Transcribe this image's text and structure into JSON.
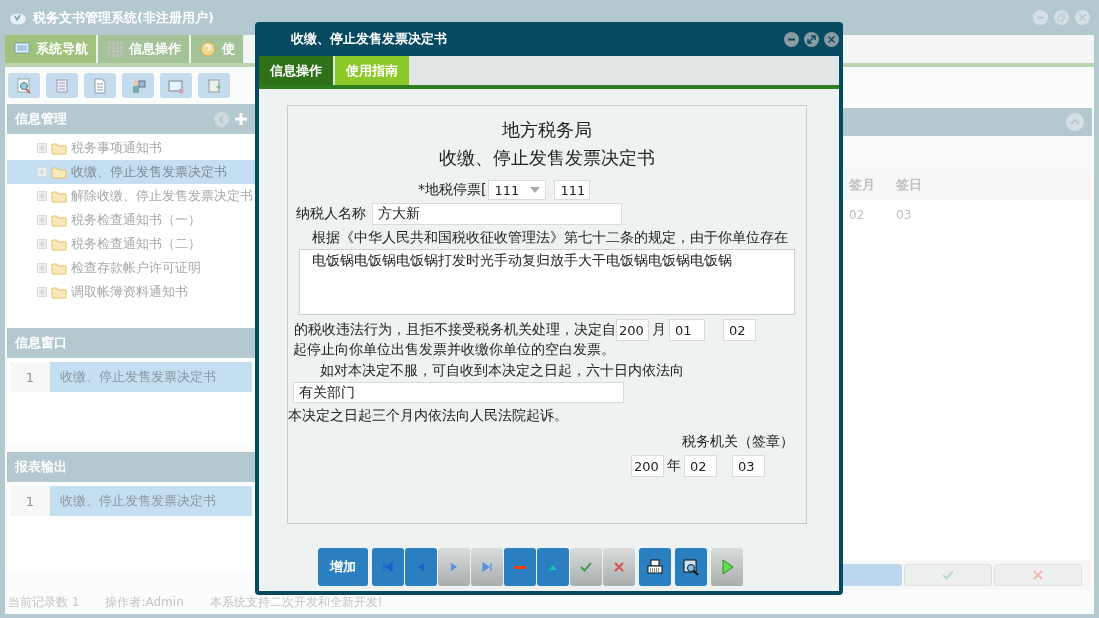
{
  "app": {
    "title": "税务文书管理系统(非注册用户)",
    "tabs": [
      {
        "label": "系统导航",
        "selected": true
      },
      {
        "label": "信息操作",
        "selected": false
      },
      {
        "label": "使",
        "selected": false
      }
    ]
  },
  "info_management": {
    "title": "信息管理",
    "items": [
      {
        "label": "税务事项通知书",
        "selected": false
      },
      {
        "label": "收缴、停止发售发票决定书",
        "selected": true
      },
      {
        "label": "解除收缴、停止发售发票决定书",
        "selected": false
      },
      {
        "label": "税务检查通知书（一）",
        "selected": false
      },
      {
        "label": "税务检查通知书（二）",
        "selected": false
      },
      {
        "label": "检查存款帐户许可证明",
        "selected": false
      },
      {
        "label": "调取帐簿资料通知书",
        "selected": false
      }
    ]
  },
  "info_window": {
    "title": "信息窗口",
    "rows": [
      {
        "index": "1",
        "label": "收缴、停止发售发票决定书",
        "selected": true
      }
    ]
  },
  "report_output": {
    "title": "报表输出",
    "rows": [
      {
        "index": "1",
        "label": "收缴、停止发售发票决定书",
        "selected": true
      }
    ]
  },
  "records": {
    "columns": [
      "签月",
      "签日"
    ],
    "rows": [
      [
        "02",
        "03"
      ]
    ]
  },
  "status_bar": [
    "当前记录数 1",
    "操作者:Admin",
    "本系统支持二次开发和全新开发!"
  ],
  "dialog": {
    "title": "收缴、停止发售发票决定书",
    "tabs": [
      {
        "label": "信息操作",
        "selected": true
      },
      {
        "label": "使用指南",
        "selected": false
      }
    ],
    "heading": "地方税务局",
    "subheading": "收缴、停止发售发票决定书",
    "number_label": "*地税停票[",
    "number_select": "111",
    "number_value": "111",
    "taxpayer_label": "纳税人名称",
    "taxpayer_value": "方大新",
    "basis_text": "根据《中华人民共和国税收征收管理法》第七十二条的规定，由于你单位存在",
    "violation_value": "电饭锅电饭锅电饭锅打发时光手动复归放手大干电饭锅电饭锅电饭锅",
    "decision_text": "的税收违法行为，且拒不接受税务机关处理，决定自",
    "start_year": "200",
    "month_label": "月",
    "start_month": "01",
    "start_day": "02",
    "stop_text": "起停止向你单位出售发票并收缴你单位的空白发票。",
    "appeal_text": "如对本决定不服，可自收到本决定之日起，六十日内依法向",
    "appeal_value": "有关部门",
    "lawsuit_text": "本决定之日起三个月内依法向人民法院起诉。",
    "signature": "税务机关（签章）",
    "sign_year": "200",
    "year_label": "年",
    "sign_month": "02",
    "sign_day": "03",
    "add_button": "增加"
  }
}
